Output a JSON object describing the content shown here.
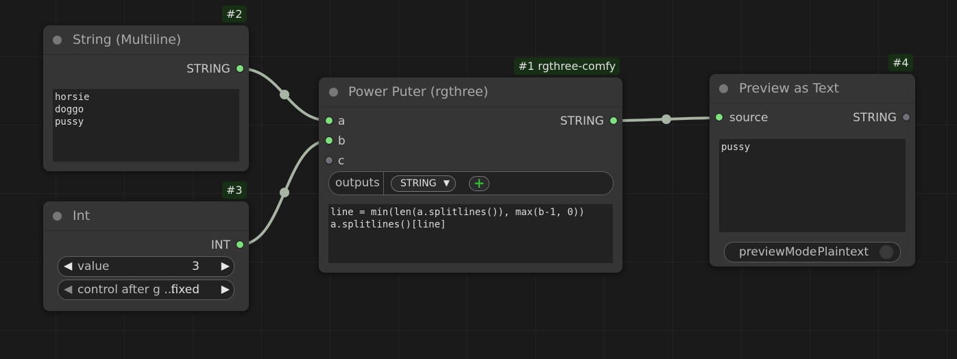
{
  "nodes": {
    "string_multiline": {
      "badge": "#2",
      "title": "String (Multiline)",
      "output_label": "STRING",
      "text": "horsie\ndoggo\npussy"
    },
    "int": {
      "badge": "#3",
      "title": "Int",
      "output_label": "INT",
      "value_label": "value",
      "value": "3",
      "control_label": "control after g …",
      "control_value": "fixed"
    },
    "power_puter": {
      "badge": "#1 rgthree-comfy",
      "title": "Power Puter (rgthree)",
      "inputs": [
        "a",
        "b",
        "c"
      ],
      "output_label": "STRING",
      "outputs_label": "outputs",
      "output_type": "STRING",
      "add_icon": "plus-icon",
      "code": "line = min(len(a.splitlines()), max(b-1, 0))\na.splitlines()[line]"
    },
    "preview_text": {
      "badge": "#4",
      "title": "Preview as Text",
      "input_label": "source",
      "output_label": "STRING",
      "text": "pussy",
      "mode_label": "previewMode",
      "mode_value": "Plaintext"
    }
  },
  "colors": {
    "canvas": "#1a1a1a",
    "node": "#353535",
    "wire": "#a8b4a4",
    "slot_connected": "#7de07d",
    "badge": "#173015"
  }
}
